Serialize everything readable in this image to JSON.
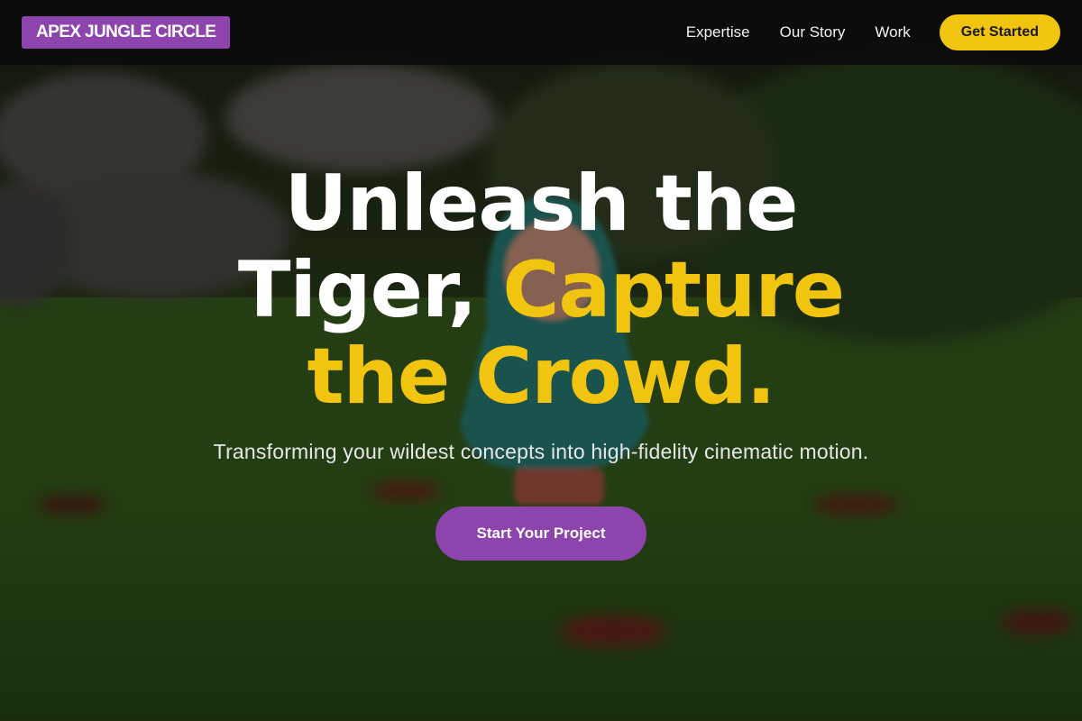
{
  "brand": {
    "logo_text": "APEX JUNGLE CIRCLE",
    "accent_purple": "#8e44ad",
    "accent_yellow": "#f1c40f"
  },
  "nav": {
    "links": [
      {
        "label": "Expertise"
      },
      {
        "label": "Our Story"
      },
      {
        "label": "Work"
      }
    ],
    "cta_label": "Get Started"
  },
  "hero": {
    "title_line1": "Unleash the",
    "title_line2_white": "Tiger,",
    "title_line2_yellow": "Capture",
    "title_line3_yellow": "the Crowd.",
    "subtitle": "Transforming your wildest concepts into high-fidelity cinematic motion.",
    "cta_label": "Start Your Project"
  }
}
